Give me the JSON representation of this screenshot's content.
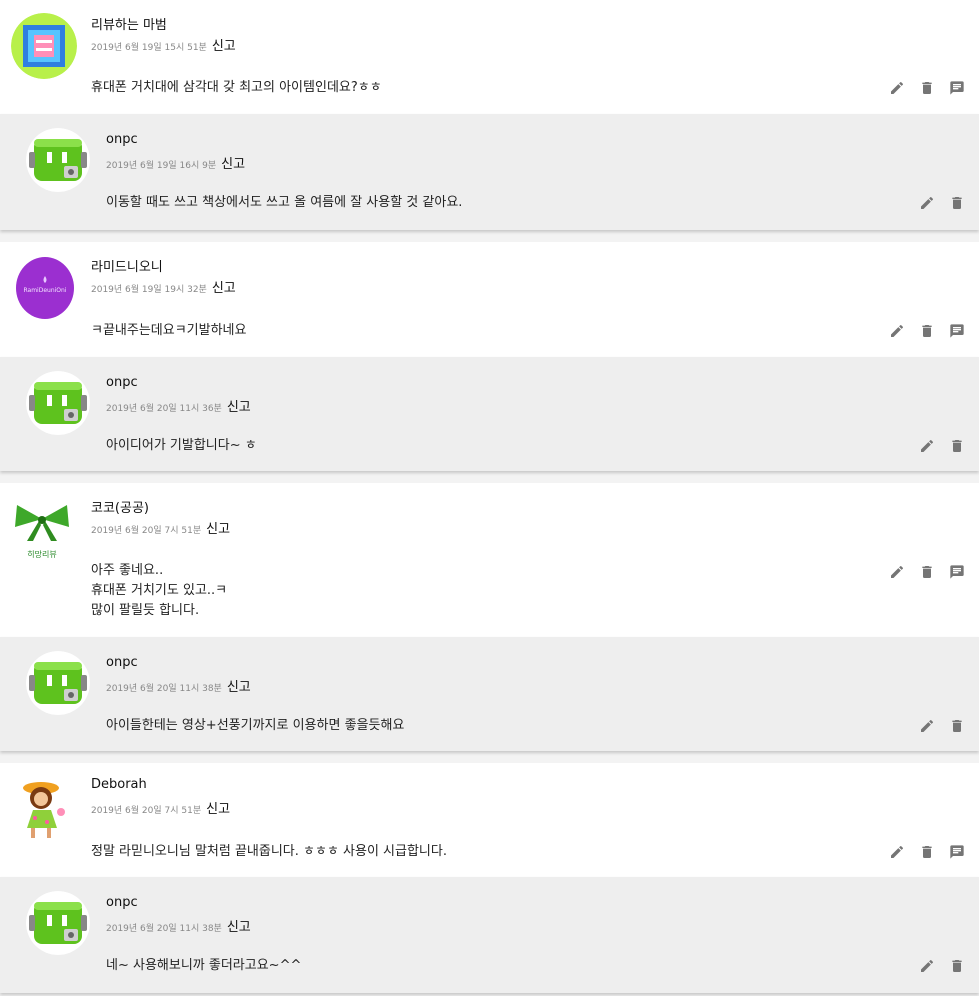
{
  "report_label": "신고",
  "threads": [
    {
      "comment": {
        "name": "리뷰하는 마범",
        "date": "2019년 6월 19일 15시 51분",
        "text": "휴대폰 거치대에 삼각대 갖 최고의 아이템인데요?ㅎㅎ",
        "avatar_icon": "blue-block-avatar-icon"
      },
      "reply": {
        "name": "onpc",
        "date": "2019년 6월 19일 16시 9분",
        "text": "이동할 때도 쓰고 책상에서도 쓰고 올 여름에 잘 사용할 것 같아요.",
        "avatar_icon": "green-robot-avatar-icon"
      }
    },
    {
      "comment": {
        "name": "라미드니오니",
        "date": "2019년 6월 19일 19시 32분",
        "text": "ㅋ끝내주는데요ㅋ기발하네요",
        "avatar_icon": "purple-circle-avatar-icon",
        "avatar_text": "RamiDeuniOni"
      },
      "reply": {
        "name": "onpc",
        "date": "2019년 6월 20일 11시 36분",
        "text": "아이디어가 기발합니다~ ㅎ",
        "avatar_icon": "green-robot-avatar-icon"
      }
    },
    {
      "comment": {
        "name": "코코(공공)",
        "date": "2019년 6월 20일 7시 51분",
        "text": "아주 좋네요..\n휴대폰 거치기도 있고..ㅋ\n많이 팔릴듯 합니다.",
        "avatar_icon": "green-ribbon-avatar-icon",
        "avatar_text": "히망리뷰"
      },
      "reply": {
        "name": "onpc",
        "date": "2019년 6월 20일 11시 38분",
        "text": "아이들한테는 영상+선풍기까지로 이용하면 좋을듯해요",
        "avatar_icon": "green-robot-avatar-icon"
      }
    },
    {
      "comment": {
        "name": "Deborah",
        "date": "2019년 6월 20일 7시 51분",
        "text": "정말 라믿니오니님 말처럼 끝내줍니다. ㅎㅎㅎ 사용이 시급합니다.",
        "avatar_icon": "cartoon-girl-avatar-icon"
      },
      "reply": {
        "name": "onpc",
        "date": "2019년 6월 20일 11시 38분",
        "text": "네~ 사용해보니까 좋더라고요~^^",
        "avatar_icon": "green-robot-avatar-icon"
      }
    }
  ]
}
